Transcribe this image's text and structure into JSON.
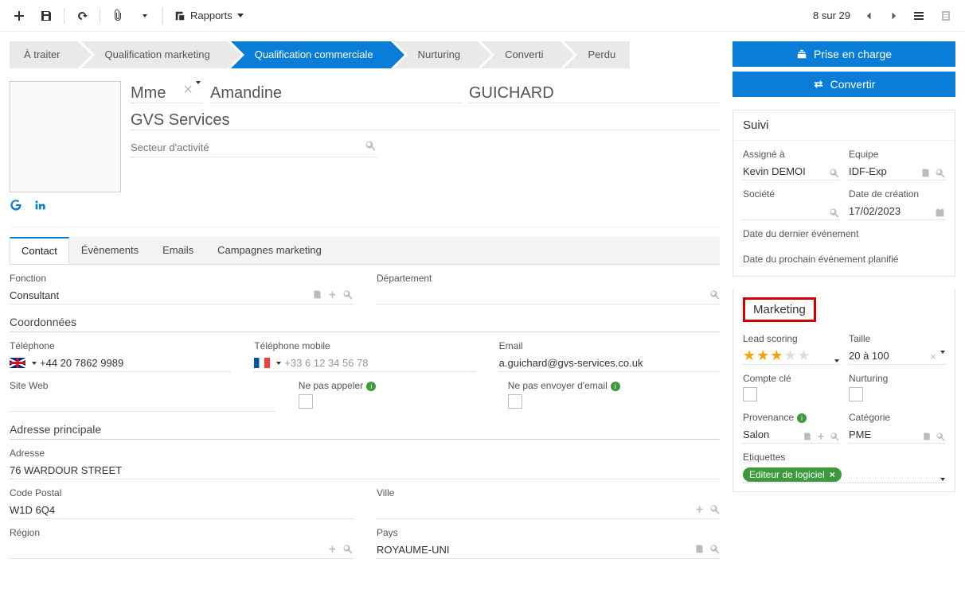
{
  "toolbar": {
    "rapports_label": "Rapports",
    "pager_text": "8 sur 29"
  },
  "stages": [
    {
      "label": "À traiter",
      "active": false
    },
    {
      "label": "Qualification marketing",
      "active": false
    },
    {
      "label": "Qualification commerciale",
      "active": true
    },
    {
      "label": "Nurturing",
      "active": false
    },
    {
      "label": "Converti",
      "active": false
    },
    {
      "label": "Perdu",
      "active": false
    }
  ],
  "person": {
    "title": "Mme",
    "first_name": "Amandine",
    "last_name": "GUICHARD",
    "company": "GVS Services",
    "sector_placeholder": "Secteur d'activité"
  },
  "actions": {
    "take_charge": "Prise en charge",
    "convert": "Convertir"
  },
  "suivi": {
    "heading": "Suivi",
    "assigne_label": "Assigné à",
    "assigne_value": "Kevin DEMOI",
    "equipe_label": "Equipe",
    "equipe_value": "IDF-Exp",
    "societe_label": "Société",
    "societe_value": "",
    "date_creation_label": "Date de création",
    "date_creation_value": "17/02/2023",
    "last_event_label": "Date du dernier événement",
    "next_event_label": "Date du prochain événement planifié"
  },
  "tabs": [
    {
      "label": "Contact",
      "active": true
    },
    {
      "label": "Évènements",
      "active": false
    },
    {
      "label": "Emails",
      "active": false
    },
    {
      "label": "Campagnes marketing",
      "active": false
    }
  ],
  "contact": {
    "fonction_label": "Fonction",
    "fonction_value": "Consultant",
    "departement_label": "Département",
    "departement_value": "",
    "coordonnees_heading": "Coordonnées",
    "telephone_label": "Téléphone",
    "telephone_value": "+44 20 7862 9989",
    "mobile_label": "Téléphone mobile",
    "mobile_value": "+33 6 12 34 56 78",
    "email_label": "Email",
    "email_value": "a.guichard@gvs-services.co.uk",
    "site_label": "Site Web",
    "no_call_label": "Ne pas appeler",
    "no_email_label": "Ne pas envoyer d'email",
    "adresse_heading": "Adresse principale",
    "adresse_label": "Adresse",
    "adresse_value": "76 WARDOUR STREET",
    "cp_label": "Code Postal",
    "cp_value": "W1D 6Q4",
    "ville_label": "Ville",
    "ville_value": "",
    "region_label": "Région",
    "region_value": "",
    "pays_label": "Pays",
    "pays_value": "ROYAUME-UNI"
  },
  "marketing": {
    "heading": "Marketing",
    "lead_scoring_label": "Lead scoring",
    "lead_scoring_stars": 3,
    "taille_label": "Taille",
    "taille_value": "20 à 100",
    "compte_cle_label": "Compte clé",
    "nurturing_label": "Nurturing",
    "provenance_label": "Provenance",
    "provenance_value": "Salon",
    "categorie_label": "Catégorie",
    "categorie_value": "PME",
    "etiquettes_label": "Etiquettes",
    "tag": "Editeur de logiciel"
  }
}
